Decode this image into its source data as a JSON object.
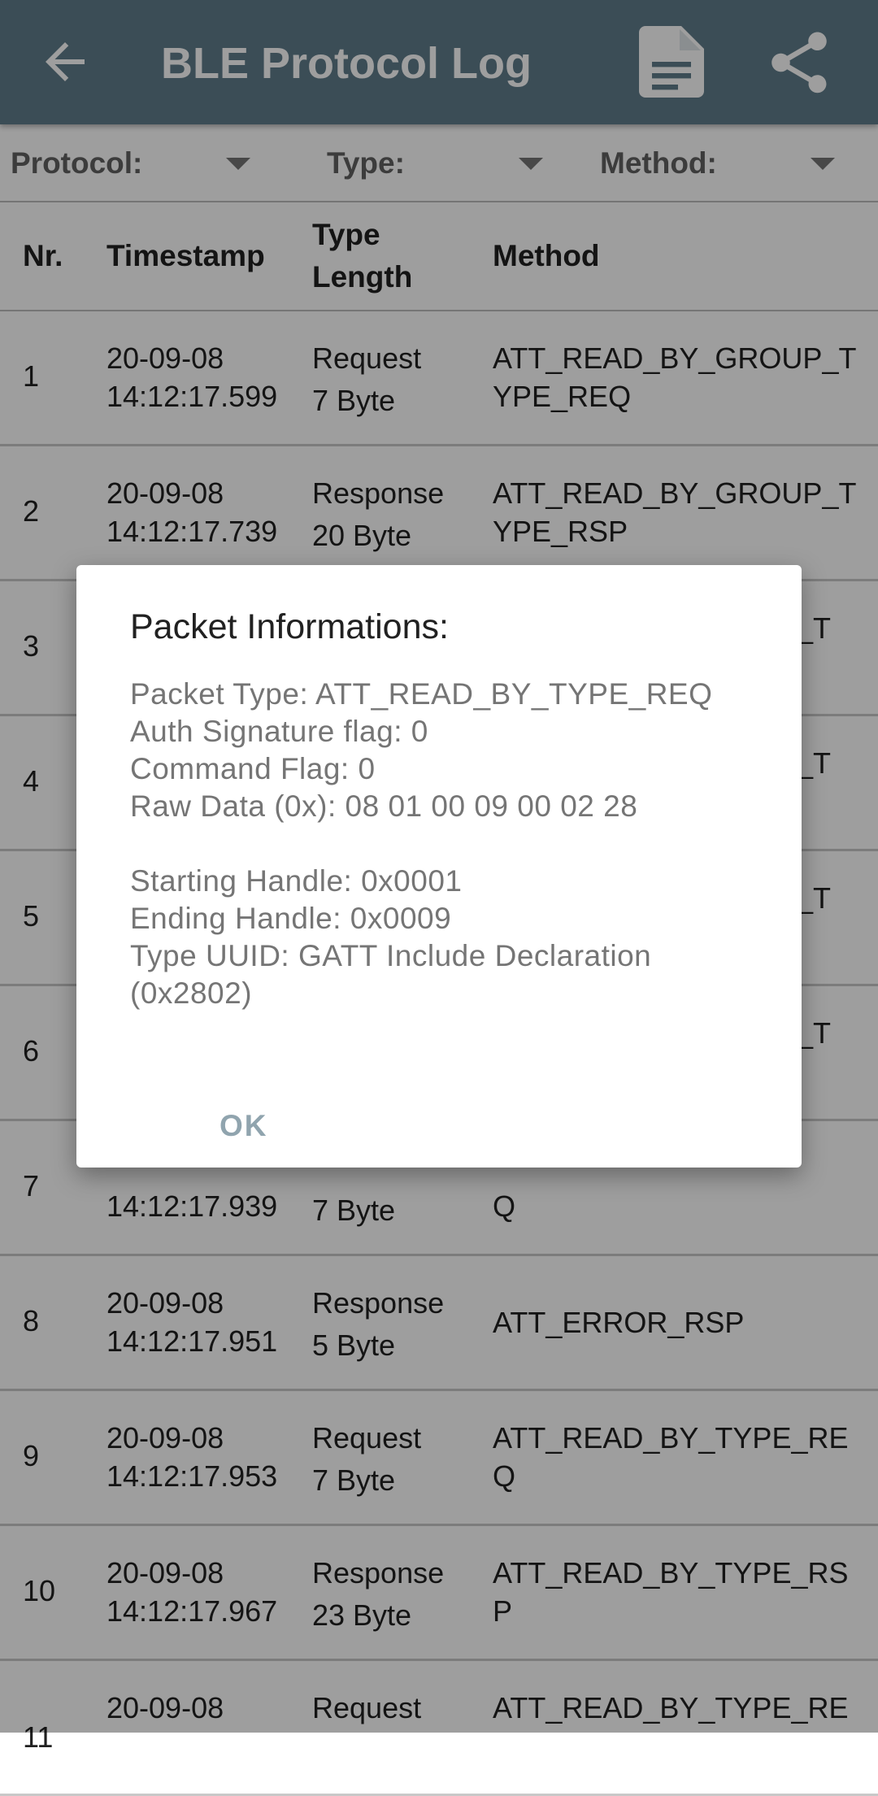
{
  "app_bar": {
    "title": "BLE Protocol Log",
    "back_icon": "arrow-back-icon",
    "doc_icon": "document-icon",
    "share_icon": "share-icon",
    "color": "#607d8b"
  },
  "filters": [
    {
      "label": "Protocol:"
    },
    {
      "label": "Type:"
    },
    {
      "label": "Method:"
    }
  ],
  "table": {
    "headers": {
      "nr": "Nr.",
      "timestamp": "Timestamp",
      "type": "Type",
      "length": "Length",
      "method": "Method"
    },
    "rows": [
      {
        "nr": "1",
        "date": "20-09-08",
        "time": "14:12:17.599",
        "type": "Request",
        "length": "7 Byte",
        "method1": "ATT_READ_BY_GROUP_T",
        "method2": "YPE_REQ"
      },
      {
        "nr": "2",
        "date": "20-09-08",
        "time": "14:12:17.739",
        "type": "Response",
        "length": "20 Byte",
        "method1": "ATT_READ_BY_GROUP_T",
        "method2": "YPE_RSP"
      },
      {
        "nr": "3",
        "date": "",
        "time": "",
        "type": "",
        "length": "",
        "method1": "P_T",
        "method2": ""
      },
      {
        "nr": "4",
        "date": "",
        "time": "",
        "type": "",
        "length": "",
        "method1": "P_T",
        "method2": ""
      },
      {
        "nr": "5",
        "date": "",
        "time": "",
        "type": "",
        "length": "",
        "method1": "P_T",
        "method2": ""
      },
      {
        "nr": "6",
        "date": "",
        "time": "",
        "type": "",
        "length": "",
        "method1": "P_T",
        "method2": ""
      },
      {
        "nr": "7",
        "date": "",
        "time": "14:12:17.939",
        "type": "",
        "length": "7 Byte",
        "method1": "",
        "method2": "Q"
      },
      {
        "nr": "8",
        "date": "20-09-08",
        "time": "14:12:17.951",
        "type": "Response",
        "length": "5 Byte",
        "method1": "",
        "method2": "",
        "method_single": "ATT_ERROR_RSP"
      },
      {
        "nr": "9",
        "date": "20-09-08",
        "time": "14:12:17.953",
        "type": "Request",
        "length": "7 Byte",
        "method1": "ATT_READ_BY_TYPE_RE",
        "method2": "Q"
      },
      {
        "nr": "10",
        "date": "20-09-08",
        "time": "14:12:17.967",
        "type": "Response",
        "length": "23 Byte",
        "method1": "ATT_READ_BY_TYPE_RS",
        "method2": "P"
      },
      {
        "nr": "11",
        "date": "20-09-08",
        "time": "",
        "type": "Request",
        "length": "",
        "method1": "ATT_READ_BY_TYPE_RE",
        "method2": ""
      }
    ]
  },
  "dialog": {
    "title": "Packet Informations:",
    "lines": [
      "Packet Type: ATT_READ_BY_TYPE_REQ",
      "Auth Signature flag: 0",
      "Command Flag: 0",
      "Raw Data (0x): 08 01 00 09 00 02 28",
      "",
      "Starting Handle: 0x0001",
      "Ending Handle: 0x0009",
      "Type UUID: GATT Include Declaration",
      "(0x2802)"
    ],
    "ok_label": "OK"
  }
}
